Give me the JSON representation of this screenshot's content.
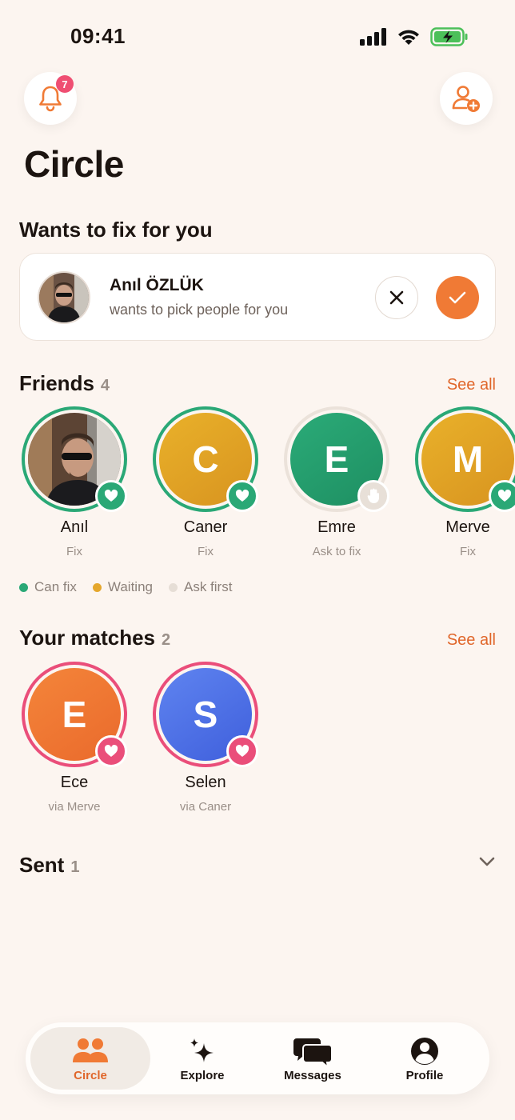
{
  "status_bar": {
    "time": "09:41"
  },
  "header": {
    "notification_count": "7",
    "page_title": "Circle"
  },
  "fix_request": {
    "section_title": "Wants to fix for you",
    "name": "Anıl ÖZLÜK",
    "subtitle": "wants to pick people for you"
  },
  "friends": {
    "title": "Friends",
    "count": "4",
    "see_all": "See all",
    "items": [
      {
        "name": "Anıl",
        "status": "Fix",
        "initial": "",
        "color": "#2aa876"
      },
      {
        "name": "Caner",
        "status": "Fix",
        "initial": "C",
        "color": "#2aa876"
      },
      {
        "name": "Emre",
        "status": "Ask to fix",
        "initial": "E",
        "color": "#ebe2da"
      },
      {
        "name": "Merve",
        "status": "Fix",
        "initial": "M",
        "color": "#2aa876"
      }
    ]
  },
  "legend": {
    "items": [
      {
        "label": "Can fix",
        "color": "#2aa876"
      },
      {
        "label": "Waiting",
        "color": "#e5a72c"
      },
      {
        "label": "Ask first",
        "color": "#e6ded6"
      }
    ]
  },
  "matches": {
    "title": "Your matches",
    "count": "2",
    "see_all": "See all",
    "items": [
      {
        "name": "Ece",
        "via": "via Merve",
        "initial": "E"
      },
      {
        "name": "Selen",
        "via": "via Caner",
        "initial": "S"
      }
    ]
  },
  "sent": {
    "title": "Sent",
    "count": "1"
  },
  "tabs": [
    {
      "label": "Circle",
      "icon": "people-icon",
      "active": true
    },
    {
      "label": "Explore",
      "icon": "sparkle-icon",
      "active": false
    },
    {
      "label": "Messages",
      "icon": "chat-bubbles-icon",
      "active": false
    },
    {
      "label": "Profile",
      "icon": "profile-icon",
      "active": false
    }
  ],
  "colors": {
    "accent": "#f07a35",
    "green": "#2aa876",
    "pink": "#ea4e7a",
    "background": "#fcf5f0"
  }
}
